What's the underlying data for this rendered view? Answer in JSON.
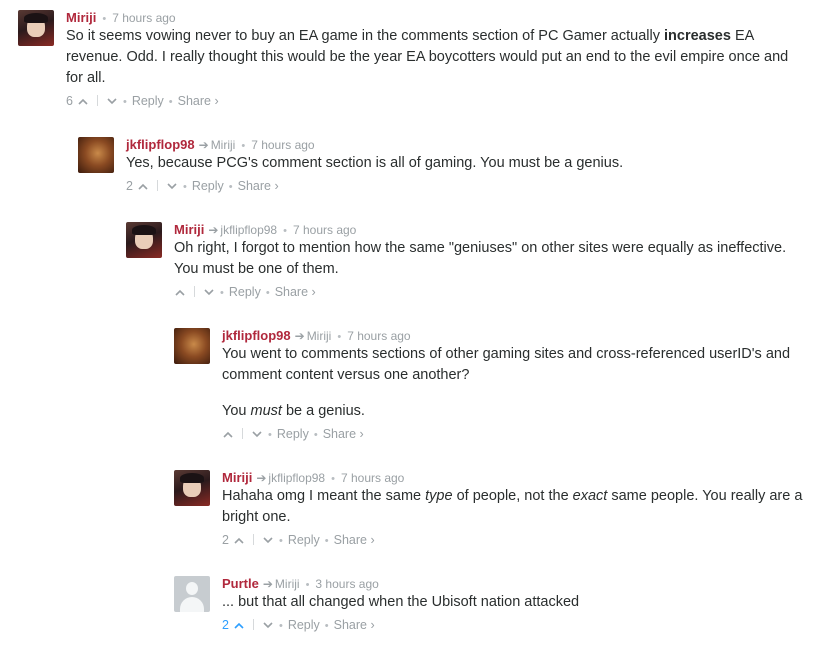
{
  "comments": [
    {
      "author": "Miriji",
      "reply_to": "",
      "time": "7 hours ago",
      "avatar": "miriji",
      "paragraphs": [
        [
          {
            "t": "So it seems vowing never to buy an EA game in the comments section of PC Gamer actually "
          },
          {
            "t": "increases",
            "style": "bold"
          },
          {
            "t": " EA revenue. Odd. I really thought this would be the year EA boycotters would put an end to the evil empire once and for all."
          }
        ]
      ],
      "votes": "6",
      "upvote_active": false,
      "reply_label": "Reply",
      "share_label": "Share ›"
    },
    {
      "author": "jkflipflop98",
      "reply_to": "Miriji",
      "time": "7 hours ago",
      "avatar": "jk",
      "paragraphs": [
        [
          {
            "t": "Yes, because PCG's comment section is all of gaming. You must be a genius."
          }
        ]
      ],
      "votes": "2",
      "upvote_active": false,
      "reply_label": "Reply",
      "share_label": "Share ›"
    },
    {
      "author": "Miriji",
      "reply_to": "jkflipflop98",
      "time": "7 hours ago",
      "avatar": "miriji",
      "paragraphs": [
        [
          {
            "t": "Oh right, I forgot to mention how the same \"geniuses\" on other sites were equally as ineffective. You must be one of them."
          }
        ]
      ],
      "votes": "",
      "upvote_active": false,
      "reply_label": "Reply",
      "share_label": "Share ›"
    },
    {
      "author": "jkflipflop98",
      "reply_to": "Miriji",
      "time": "7 hours ago",
      "avatar": "jk",
      "paragraphs": [
        [
          {
            "t": "You went to comments sections of other gaming sites and cross-referenced userID's and comment content versus one another?"
          }
        ],
        [
          {
            "t": "You "
          },
          {
            "t": "must",
            "style": "italic"
          },
          {
            "t": " be a genius."
          }
        ]
      ],
      "votes": "",
      "upvote_active": false,
      "reply_label": "Reply",
      "share_label": "Share ›"
    },
    {
      "author": "Miriji",
      "reply_to": "jkflipflop98",
      "time": "7 hours ago",
      "avatar": "miriji",
      "paragraphs": [
        [
          {
            "t": "Hahaha omg I meant the same "
          },
          {
            "t": "type",
            "style": "italic"
          },
          {
            "t": " of people, not the "
          },
          {
            "t": "exact",
            "style": "italic"
          },
          {
            "t": " same people. You really are a bright one."
          }
        ]
      ],
      "votes": "2",
      "upvote_active": false,
      "reply_label": "Reply",
      "share_label": "Share ›"
    },
    {
      "author": "Purtle",
      "reply_to": "Miriji",
      "time": "3 hours ago",
      "avatar": "purtle",
      "paragraphs": [
        [
          {
            "t": "... but that all changed when the Ubisoft nation attacked"
          }
        ]
      ],
      "votes": "2",
      "upvote_active": true,
      "reply_label": "Reply",
      "share_label": "Share ›"
    }
  ],
  "colors": {
    "author": "#b0283c",
    "meta": "#9aa0a4",
    "active_vote": "#2e9fff"
  },
  "icons": {
    "upvote": "chevron-up-icon",
    "downvote": "chevron-down-icon",
    "reply_to": "reply-arrow-icon"
  }
}
